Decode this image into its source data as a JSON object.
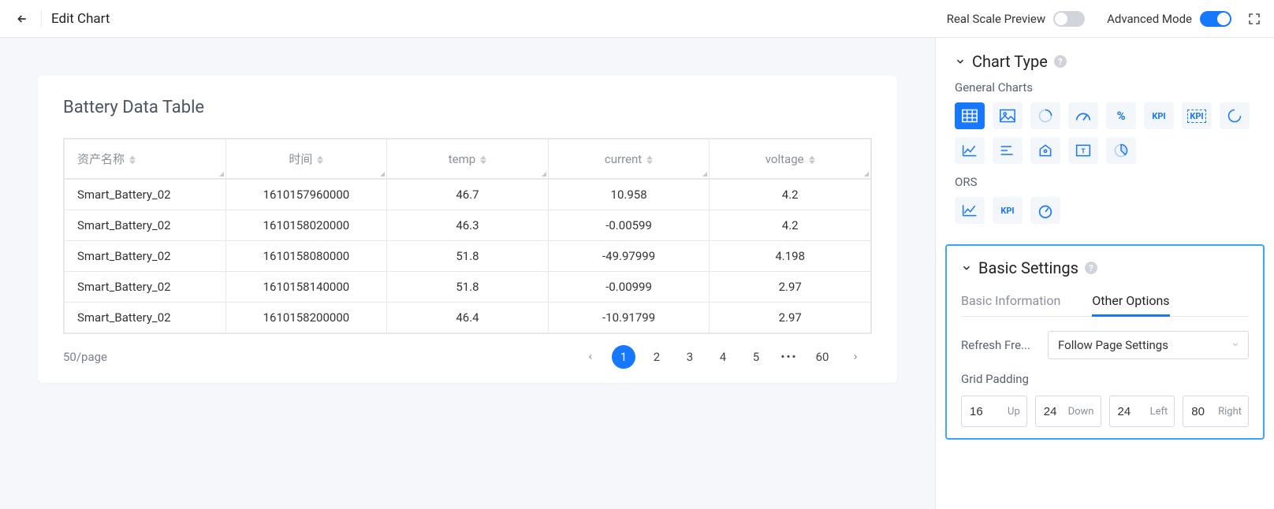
{
  "header": {
    "title": "Edit Chart",
    "real_scale_label": "Real Scale Preview",
    "real_scale_on": false,
    "advanced_label": "Advanced Mode",
    "advanced_on": true
  },
  "card": {
    "title": "Battery Data Table"
  },
  "table": {
    "columns": [
      {
        "key": "asset",
        "label": "资产名称"
      },
      {
        "key": "time",
        "label": "时间"
      },
      {
        "key": "temp",
        "label": "temp"
      },
      {
        "key": "current",
        "label": "current"
      },
      {
        "key": "voltage",
        "label": "voltage"
      }
    ],
    "rows": [
      {
        "asset": "Smart_Battery_02",
        "time": "1610157960000",
        "temp": "46.7",
        "current": "10.958",
        "voltage": "4.2"
      },
      {
        "asset": "Smart_Battery_02",
        "time": "1610158020000",
        "temp": "46.3",
        "current": "-0.00599",
        "voltage": "4.2"
      },
      {
        "asset": "Smart_Battery_02",
        "time": "1610158080000",
        "temp": "51.8",
        "current": "-49.97999",
        "voltage": "4.198"
      },
      {
        "asset": "Smart_Battery_02",
        "time": "1610158140000",
        "temp": "51.8",
        "current": "-0.00999",
        "voltage": "2.97"
      },
      {
        "asset": "Smart_Battery_02",
        "time": "1610158200000",
        "temp": "46.4",
        "current": "-10.91799",
        "voltage": "2.97"
      }
    ]
  },
  "pagination": {
    "page_size_label": "50/page",
    "pages": [
      "1",
      "2",
      "3",
      "4",
      "5"
    ],
    "active_index": 0,
    "ellipsis": "•••",
    "last": "60"
  },
  "sidebar": {
    "chart_type": {
      "title": "Chart Type",
      "general_label": "General Charts",
      "ors_label": "ORS",
      "general_icons": [
        "table",
        "image",
        "progress-circle",
        "gauge",
        "percent",
        "kpi",
        "kpi-alt",
        "loading-circle",
        "line-chart",
        "bar-horizontal",
        "map-pin",
        "text-box",
        "pie-arc"
      ],
      "ors_icons": [
        "line-chart",
        "kpi",
        "gauge-dashboard"
      ]
    },
    "basic_settings": {
      "title": "Basic Settings",
      "tabs": {
        "basic_info": "Basic Information",
        "other_options": "Other Options"
      },
      "refresh_label": "Refresh Fre...",
      "refresh_value": "Follow Page Settings",
      "grid_label": "Grid Padding",
      "padding": {
        "up": {
          "value": "16",
          "label": "Up"
        },
        "down": {
          "value": "24",
          "label": "Down"
        },
        "left": {
          "value": "24",
          "label": "Left"
        },
        "right": {
          "value": "80",
          "label": "Right"
        }
      }
    }
  }
}
